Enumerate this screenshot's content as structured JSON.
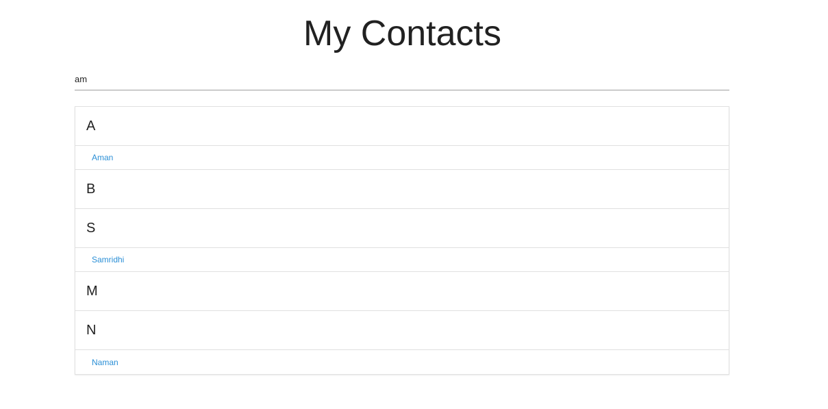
{
  "page": {
    "title": "My Contacts"
  },
  "search": {
    "value": "am",
    "placeholder": ""
  },
  "groups": [
    {
      "letter": "A",
      "contacts": [
        "Aman"
      ]
    },
    {
      "letter": "B",
      "contacts": []
    },
    {
      "letter": "S",
      "contacts": [
        "Samridhi"
      ]
    },
    {
      "letter": "M",
      "contacts": []
    },
    {
      "letter": "N",
      "contacts": [
        "Naman"
      ]
    }
  ],
  "colors": {
    "link": "#2b8fd6",
    "divider": "#e0e0e0",
    "text": "#212121"
  }
}
